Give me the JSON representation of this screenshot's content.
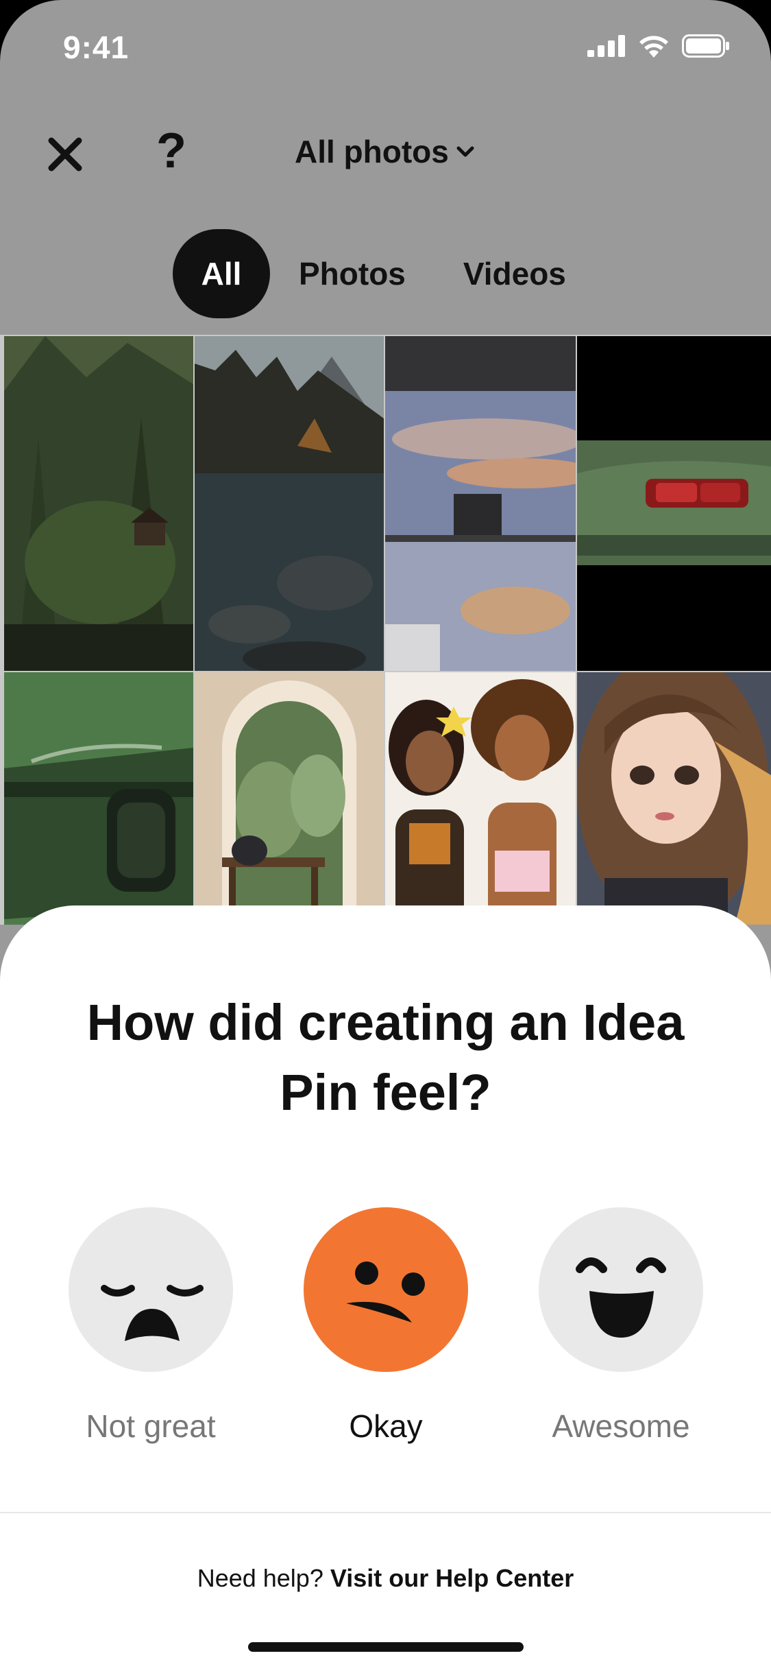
{
  "status_bar": {
    "time": "9:41"
  },
  "header": {
    "album_label": "All photos",
    "help_label": "?"
  },
  "filters": [
    "All",
    "Photos",
    "Videos"
  ],
  "gallery": {
    "tiles": [
      "forest-cabin-photo",
      "mountain-lake-photo",
      "sunset-kitchen-photo",
      "green-car-taillight-photo",
      "green-car-side-photo",
      "arched-window-room-photo",
      "illustrated-friends-photo",
      "anime-girl-portrait-photo"
    ]
  },
  "feedback": {
    "title": "How did creating an Idea Pin feel?",
    "options": [
      {
        "label": "Not great",
        "icon": "sad-face-icon"
      },
      {
        "label": "Okay",
        "icon": "neutral-face-icon",
        "selected": true
      },
      {
        "label": "Awesome",
        "icon": "happy-face-icon"
      }
    ],
    "help_prefix": "Need help?",
    "help_link": "Visit our Help Center"
  },
  "colors": {
    "selected_face": "#f27632",
    "unselected_face": "#e9e9e9",
    "overlay": "#9a9a9a"
  }
}
